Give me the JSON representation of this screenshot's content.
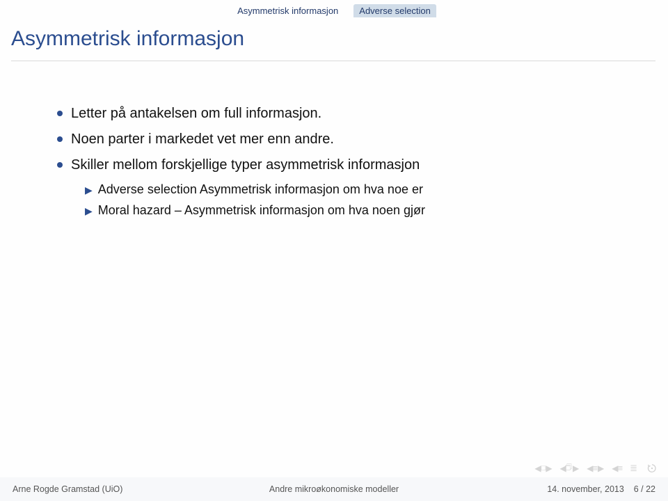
{
  "header": {
    "tab_left": "Asymmetrisk informasjon",
    "tab_right": "Adverse selection"
  },
  "title": "Asymmetrisk informasjon",
  "bullets": [
    {
      "text": "Letter på antakelsen om full informasjon."
    },
    {
      "text": "Noen parter i markedet vet mer enn andre."
    },
    {
      "text": "Skiller mellom forskjellige typer asymmetrisk informasjon",
      "sub": [
        "Adverse selection Asymmetrisk informasjon om hva noe er",
        "Moral hazard – Asymmetrisk informasjon om hva noen gjør"
      ]
    }
  ],
  "footer": {
    "left": "Arne Rogde Gramstad (UiO)",
    "center": "Andre mikroøkonomiske modeller",
    "right_date": "14. november, 2013",
    "right_page": "6 / 22"
  }
}
